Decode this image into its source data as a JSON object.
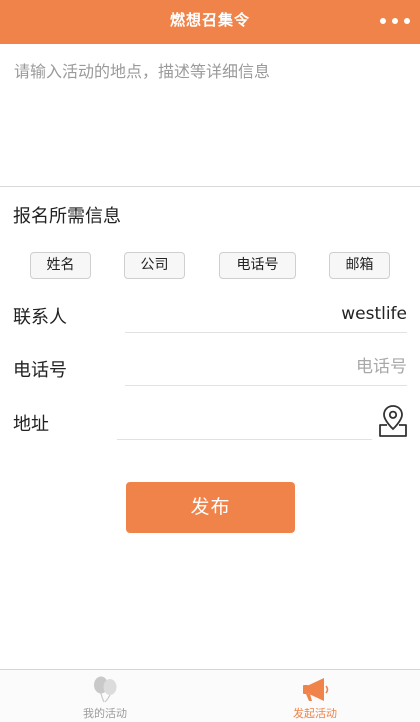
{
  "header": {
    "title": "燃想召集令"
  },
  "description": {
    "placeholder": "请输入活动的地点，描述等详细信息",
    "value": ""
  },
  "signup_section": {
    "title": "报名所需信息",
    "chips": [
      "姓名",
      "公司",
      "电话号",
      "邮箱"
    ]
  },
  "form": {
    "contact": {
      "label": "联系人",
      "value": "westlife"
    },
    "phone": {
      "label": "电话号",
      "placeholder": "电话号",
      "value": ""
    },
    "address": {
      "label": "地址",
      "value": ""
    }
  },
  "publish_button": {
    "label": "发布"
  },
  "tabbar": {
    "tabs": [
      {
        "label": "我的活动",
        "icon": "balloons-icon",
        "active": false
      },
      {
        "label": "发起活动",
        "icon": "megaphone-icon",
        "active": true
      }
    ]
  },
  "colors": {
    "accent": "#f0834a",
    "inactive_tab": "#9c9c9c"
  }
}
